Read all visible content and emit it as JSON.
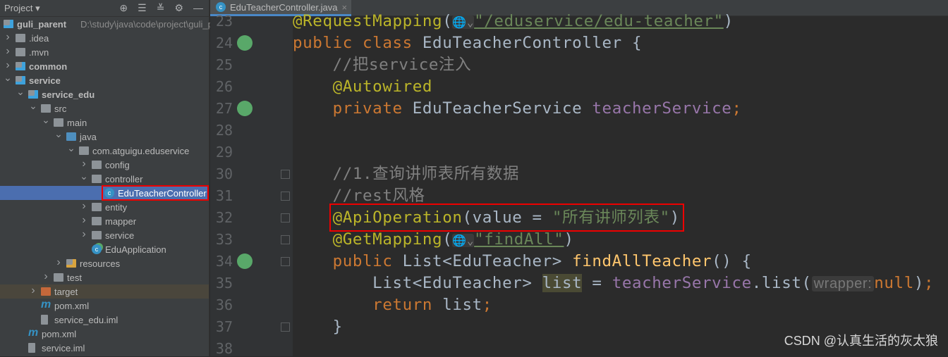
{
  "sidebar": {
    "title": "Project",
    "tools": [
      "locate-icon",
      "expand-all-icon",
      "collapse-all-icon",
      "gear-icon",
      "minimize-icon"
    ],
    "items": [
      {
        "label": "guli_parent",
        "extra": "D:\\study\\java\\code\\project\\guli_pa",
        "depth": 0,
        "arrow": "",
        "icon": "module-folder",
        "bold": true
      },
      {
        "label": ".idea",
        "depth": 0,
        "arrow": "right",
        "icon": "folder"
      },
      {
        "label": ".mvn",
        "depth": 0,
        "arrow": "right",
        "icon": "folder"
      },
      {
        "label": "common",
        "depth": 0,
        "arrow": "right",
        "icon": "module-folder",
        "bold": true
      },
      {
        "label": "service",
        "depth": 0,
        "arrow": "down",
        "icon": "module-folder",
        "bold": true
      },
      {
        "label": "service_edu",
        "depth": 1,
        "arrow": "down",
        "icon": "module-folder",
        "bold": true
      },
      {
        "label": "src",
        "depth": 2,
        "arrow": "down",
        "icon": "folder"
      },
      {
        "label": "main",
        "depth": 3,
        "arrow": "down",
        "icon": "folder"
      },
      {
        "label": "java",
        "depth": 4,
        "arrow": "down",
        "icon": "source-folder"
      },
      {
        "label": "com.atguigu.eduservice",
        "depth": 5,
        "arrow": "down",
        "icon": "package"
      },
      {
        "label": "config",
        "depth": 6,
        "arrow": "right",
        "icon": "package"
      },
      {
        "label": "controller",
        "depth": 6,
        "arrow": "down",
        "icon": "package"
      },
      {
        "label": "EduTeacherController",
        "depth": 7,
        "arrow": "",
        "icon": "class",
        "selected": true
      },
      {
        "label": "entity",
        "depth": 6,
        "arrow": "right",
        "icon": "package"
      },
      {
        "label": "mapper",
        "depth": 6,
        "arrow": "right",
        "icon": "package"
      },
      {
        "label": "service",
        "depth": 6,
        "arrow": "right",
        "icon": "package"
      },
      {
        "label": "EduApplication",
        "depth": 6,
        "arrow": "",
        "icon": "spring-boot-class"
      },
      {
        "label": "resources",
        "depth": 4,
        "arrow": "right",
        "icon": "resources-folder"
      },
      {
        "label": "test",
        "depth": 3,
        "arrow": "right",
        "icon": "folder"
      },
      {
        "label": "target",
        "depth": 2,
        "arrow": "right",
        "icon": "excluded-folder",
        "target": true
      },
      {
        "label": "pom.xml",
        "depth": 2,
        "arrow": "",
        "icon": "maven"
      },
      {
        "label": "service_edu.iml",
        "depth": 2,
        "arrow": "",
        "icon": "iml-file"
      },
      {
        "label": "pom.xml",
        "depth": 1,
        "arrow": "",
        "icon": "maven"
      },
      {
        "label": "service.iml",
        "depth": 1,
        "arrow": "",
        "icon": "iml-file"
      }
    ]
  },
  "tab": {
    "label": "EduTeacherController.java",
    "icon": "java-class-icon",
    "close": "×"
  },
  "colors": {
    "kw": "#cc7832",
    "ann": "#bbb529",
    "str": "#6a8759",
    "cm": "#808080",
    "fld": "#9876aa",
    "fn": "#ffc66d",
    "tx": "#a9b7c6"
  },
  "code": {
    "lines": [
      {
        "n": "23",
        "tokens": [
          {
            "t": "@RequestMapping",
            "c": "ann"
          },
          {
            "t": "(",
            "c": "tx"
          },
          {
            "t": "🌐⌄",
            "c": "globe"
          },
          {
            "t": "\"/eduservice/edu-teacher\"",
            "c": "str"
          },
          {
            "t": ")",
            "c": "tx"
          }
        ]
      },
      {
        "n": "24",
        "gutter": "bean",
        "tokens": [
          {
            "t": "public class ",
            "c": "kw"
          },
          {
            "t": "EduTeacherController {",
            "c": "tx"
          }
        ]
      },
      {
        "n": "25",
        "tokens": [
          {
            "t": "    //把service注入",
            "c": "cm"
          }
        ]
      },
      {
        "n": "26",
        "tokens": [
          {
            "t": "    "
          },
          {
            "t": "@Autowired",
            "c": "ann"
          }
        ]
      },
      {
        "n": "27",
        "gutter": "bean",
        "tokens": [
          {
            "t": "    private ",
            "c": "kw"
          },
          {
            "t": "EduTeacherService ",
            "c": "tx"
          },
          {
            "t": "teacherService",
            "c": "fld"
          },
          {
            "t": ";",
            "c": "kw"
          }
        ]
      },
      {
        "n": "28",
        "tokens": []
      },
      {
        "n": "29",
        "tokens": []
      },
      {
        "n": "30",
        "fold": true,
        "tokens": [
          {
            "t": "    //1.查询讲师表所有数据",
            "c": "cm"
          }
        ]
      },
      {
        "n": "31",
        "fold": true,
        "tokens": [
          {
            "t": "    //rest风格",
            "c": "cm"
          }
        ]
      },
      {
        "n": "32",
        "fold": true,
        "tokens": [
          {
            "t": "    "
          },
          {
            "t": "@ApiOperation",
            "c": "ann"
          },
          {
            "t": "(value = ",
            "c": "tx"
          },
          {
            "t": "\"所有讲师列表\"",
            "c": "str"
          },
          {
            "t": ")",
            "c": "tx"
          }
        ]
      },
      {
        "n": "33",
        "fold": true,
        "tokens": [
          {
            "t": "    "
          },
          {
            "t": "@GetMapping",
            "c": "ann"
          },
          {
            "t": "(",
            "c": "tx"
          },
          {
            "t": "🌐⌄",
            "c": "globe"
          },
          {
            "t": "\"findAll\"",
            "c": "str"
          },
          {
            "t": ")",
            "c": "tx"
          }
        ]
      },
      {
        "n": "34",
        "gutter": "web",
        "fold": true,
        "tokens": [
          {
            "t": "    public ",
            "c": "kw"
          },
          {
            "t": "List<EduTeacher> ",
            "c": "tx"
          },
          {
            "t": "findAllTeacher",
            "c": "fn"
          },
          {
            "t": "() {",
            "c": "tx"
          }
        ]
      },
      {
        "n": "35",
        "tokens": [
          {
            "t": "        List<EduTeacher> ",
            "c": "tx"
          },
          {
            "t": "list",
            "c": "tx",
            "bg": "#4a4a34"
          },
          {
            "t": " = ",
            "c": "tx"
          },
          {
            "t": "teacherService",
            "c": "fld"
          },
          {
            "t": ".list(",
            "c": "tx"
          },
          {
            "t": "wrapper:",
            "c": "hint"
          },
          {
            "t": "null",
            "c": "kw"
          },
          {
            "t": ")",
            "c": "tx"
          },
          {
            "t": ";",
            "c": "kw"
          }
        ]
      },
      {
        "n": "36",
        "tokens": [
          {
            "t": "        return ",
            "c": "kw"
          },
          {
            "t": "list",
            "c": "tx"
          },
          {
            "t": ";",
            "c": "kw"
          }
        ]
      },
      {
        "n": "37",
        "fold": true,
        "tokens": [
          {
            "t": "    }",
            "c": "tx"
          }
        ]
      },
      {
        "n": "38",
        "tokens": []
      }
    ]
  },
  "watermark": "CSDN @认真生活的灰太狼"
}
